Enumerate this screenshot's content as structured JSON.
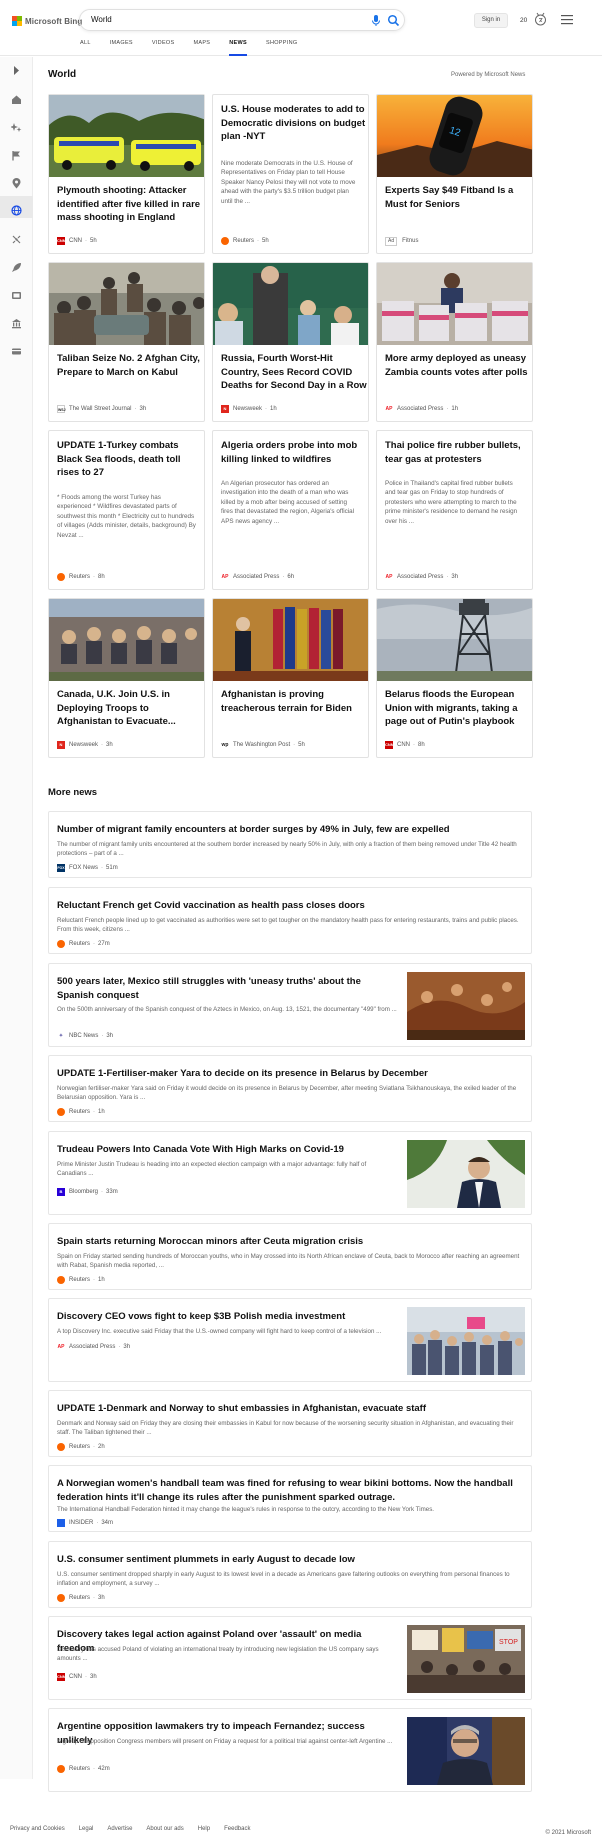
{
  "header": {
    "brand": "Microsoft Bing",
    "search_value": "World",
    "signin_label": "Sign in",
    "rewards_count": "20",
    "tabs": [
      {
        "label": "ALL"
      },
      {
        "label": "IMAGES"
      },
      {
        "label": "VIDEOS"
      },
      {
        "label": "MAPS"
      },
      {
        "label": "NEWS",
        "active": true
      },
      {
        "label": "SHOPPING"
      }
    ]
  },
  "sidebar": {
    "items": [
      {
        "icon": "expand-icon"
      },
      {
        "icon": "home-icon"
      },
      {
        "icon": "sparkle-icon"
      },
      {
        "icon": "flag-icon"
      },
      {
        "icon": "location-icon"
      },
      {
        "icon": "globe-icon",
        "selected": true
      },
      {
        "icon": "science-icon"
      },
      {
        "icon": "rocket-icon"
      },
      {
        "icon": "entertainment-icon"
      },
      {
        "icon": "bank-icon"
      },
      {
        "icon": "card-icon"
      }
    ]
  },
  "world": {
    "title": "World",
    "powered_by": "Powered by Microsoft News"
  },
  "cards": [
    {
      "title": "Plymouth shooting: Attacker identified after five killed in rare mass shooting in England",
      "source": "CNN",
      "time": "5h",
      "image": "police-cars"
    },
    {
      "title": "U.S. House moderates to add to Democratic divisions on budget plan -NYT",
      "snippet": "Nine moderate Democrats in the U.S. House of Representatives on Friday plan to tell House Speaker Nancy Pelosi they will not vote to move ahead with the party's $3.5 trillion budget plan until the ...",
      "source": "Reuters",
      "time": "5h"
    },
    {
      "title": "Experts Say $49 Fitband Is a Must for Seniors",
      "ad": "Ad",
      "source": "Fitnus",
      "image": "fitband"
    },
    {
      "title": "Taliban Seize No. 2 Afghan City, Prepare to March on Kabul",
      "source": "The Wall Street Journal",
      "time": "3h",
      "image": "crowd"
    },
    {
      "title": "Russia, Fourth Worst-Hit Country, Sees Record COVID Deaths for Second Day in a Row",
      "source": "Newsweek",
      "time": "1h",
      "image": "classroom"
    },
    {
      "title": "More army deployed as uneasy Zambia counts votes after polls",
      "source": "Associated Press",
      "time": "1h",
      "image": "ballot-boxes"
    },
    {
      "title": "UPDATE 1-Turkey combats Black Sea floods, death toll rises to 27",
      "snippet": "* Floods among the worst Turkey has experienced * Wildfires devastated parts of southwest this month * Electricity cut to hundreds of villages (Adds minister, details, background) By Nevzat ...",
      "source": "Reuters",
      "time": "8h"
    },
    {
      "title": "Algeria orders probe into mob killing linked to wildfires",
      "snippet": "An Algerian prosecutor has ordered an investigation into the death of a man who was killed by a mob after being accused of setting fires that devastated the region, Algeria's official APS news agency ...",
      "source": "Associated Press",
      "time": "6h"
    },
    {
      "title": "Thai police fire rubber bullets, tear gas at protesters",
      "snippet": "Police in Thailand's capital fired rubber bullets and tear gas on Friday to stop hundreds of protesters who were attempting to march to the prime minister's residence to demand he resign over his ...",
      "source": "Associated Press",
      "time": "3h"
    },
    {
      "title": "Canada, U.K. Join U.S. in Deploying Troops to Afghanistan to Evacuate...",
      "source": "Newsweek",
      "time": "3h",
      "image": "mural"
    },
    {
      "title": "Afghanistan is proving treacherous terrain for Biden",
      "source": "The Washington Post",
      "time": "5h",
      "image": "flags"
    },
    {
      "title": "Belarus floods the European Union with migrants, taking a page out of Putin's playbook",
      "source": "CNN",
      "time": "8h",
      "image": "watchtower"
    }
  ],
  "more_news": {
    "title": "More news",
    "items": [
      {
        "title": "Number of migrant family encounters at border surges by 49% in July, few are expelled",
        "snippet": "The number of migrant family units encountered at the southern border increased by nearly 50% in July, with only a fraction of them being removed under Title 42 health protections – part of a ...",
        "source": "FOX News",
        "time": "51m"
      },
      {
        "title": "Reluctant French get Covid vaccination as health pass closes doors",
        "snippet": "Reluctant French people lined up to get vaccinated as authorities were set to get tougher on the mandatory health pass for entering restaurants, trains and public places. From this week, citizens ...",
        "source": "Reuters",
        "time": "27m"
      },
      {
        "title": "500 years later, Mexico still struggles with 'uneasy truths' about the Spanish conquest",
        "snippet": "On the 500th anniversary of the Spanish conquest of the Aztecs in Mexico, on Aug. 13, 1521, the documentary \"499\" from ...",
        "source": "NBC News",
        "time": "3h",
        "image": "mural-art"
      },
      {
        "title": "UPDATE 1-Fertiliser-maker Yara to decide on its presence in Belarus by December",
        "snippet": "Norwegian fertiliser-maker Yara said on Friday it would decide on its presence in Belarus by December, after meeting Sviatlana Tsikhanouskaya, the exiled leader of the Belarusian opposition. Yara is ...",
        "source": "Reuters",
        "time": "1h"
      },
      {
        "title": "Trudeau Powers Into Canada Vote With High Marks on Covid-19",
        "snippet": "Prime Minister Justin Trudeau is heading into an expected election campaign with a major advantage: fully half of Canadians ...",
        "source": "Bloomberg",
        "time": "33m",
        "image": "trudeau"
      },
      {
        "title": "Spain starts returning Moroccan minors after Ceuta migration crisis",
        "snippet": "Spain on Friday started sending hundreds of Moroccan youths, who in May crossed into its North African enclave of Ceuta, back to Morocco after reaching an agreement with Rabat, Spanish media reported, ...",
        "source": "Reuters",
        "time": "1h"
      },
      {
        "title": "Discovery CEO vows fight to keep $3B Polish media investment",
        "snippet": "A top Discovery Inc. executive said Friday that the U.S.-owned company will fight hard to keep control of a television ...",
        "source": "Associated Press",
        "time": "3h",
        "image": "protest"
      },
      {
        "title": "UPDATE 1-Denmark and Norway to shut embassies in Afghanistan, evacuate staff",
        "snippet": "Denmark and Norway said on Friday they are closing their embassies in Kabul for now because of the worsening security situation in Afghanistan, and evacuating their staff. The Taliban tightened their ...",
        "source": "Reuters",
        "time": "2h"
      },
      {
        "title": "A Norwegian women's handball team was fined for refusing to wear bikini bottoms. Now the handball federation hints it'll change its rules after the punishment sparked outrage.",
        "snippet": "The International Handball Federation hinted it may change the league's rules in response to the outcry, according to the New York Times.",
        "source": "INSIDER",
        "time": "34m"
      },
      {
        "title": "U.S. consumer sentiment plummets in early August to decade low",
        "snippet": "U.S. consumer sentiment dropped sharply in early August to its lowest level in a decade as Americans gave faltering outlooks on everything from personal finances to inflation and employment, a survey ...",
        "source": "Reuters",
        "time": "3h"
      },
      {
        "title": "Discovery takes legal action against Poland over 'assault' on media freedom",
        "snippet": "Discovery has accused Poland of violating an international treaty by introducing new legislation the US company says amounts ...",
        "source": "CNN",
        "time": "3h",
        "image": "protest-signs"
      },
      {
        "title": "Argentine opposition lawmakers try to impeach Fernandez; success unlikely",
        "snippet": "A group of opposition Congress members will present on Friday a request for a political trial against center-left Argentine ...",
        "source": "Reuters",
        "time": "42m",
        "image": "fernandez"
      }
    ]
  },
  "footer": {
    "links": [
      "Privacy and Cookies",
      "Legal",
      "Advertise",
      "About our ads",
      "Help",
      "Feedback"
    ],
    "copyright": "© 2021 Microsoft"
  },
  "colors": {
    "accent": "#174ae4",
    "reuters": "#fa6400",
    "cnn": "#cc0000",
    "newsweek": "#e0261d",
    "ap": "#ee1c25",
    "bloomberg": "#2800d7",
    "insider": "#1c5fe8",
    "fox": "#003366"
  }
}
